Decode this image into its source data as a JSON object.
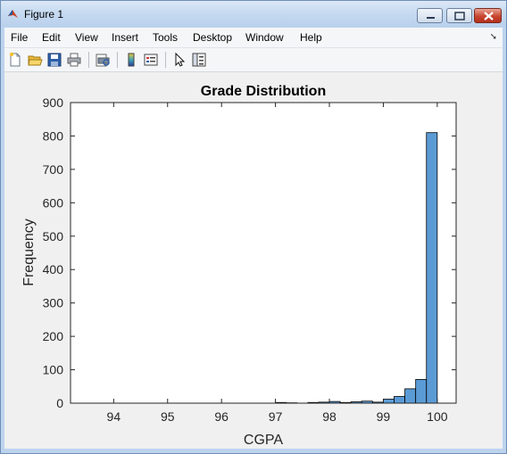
{
  "window": {
    "title": "Figure 1"
  },
  "menubar": {
    "items": [
      "File",
      "Edit",
      "View",
      "Insert",
      "Tools",
      "Desktop",
      "Window",
      "Help"
    ]
  },
  "toolbar": {
    "buttons": [
      "new-figure-icon",
      "open-file-icon",
      "save-icon",
      "print-icon",
      "print-preview-icon",
      "insert-colorbar-icon",
      "insert-legend-icon",
      "edit-plot-pointer-icon",
      "property-inspector-icon"
    ]
  },
  "colors": {
    "bar_fill": "#5b9bd5",
    "bar_edge": "#000000",
    "figure_bg": "#f0f0f0",
    "axes_bg": "#ffffff"
  },
  "chart_data": {
    "type": "bar",
    "title": "Grade Distribution",
    "xlabel": "CGPA",
    "ylabel": "Frequency",
    "xlim": [
      93.2,
      100.35
    ],
    "ylim": [
      0,
      900
    ],
    "xticks": [
      94,
      95,
      96,
      97,
      98,
      99,
      100
    ],
    "yticks": [
      0,
      100,
      200,
      300,
      400,
      500,
      600,
      700,
      800,
      900
    ],
    "grid": false,
    "bin_edges": [
      97.0,
      97.2,
      97.4,
      97.6,
      97.8,
      98.0,
      98.2,
      98.4,
      98.6,
      98.8,
      99.0,
      99.2,
      99.4,
      99.6,
      99.8,
      100.0
    ],
    "values": [
      2,
      1,
      0,
      2,
      3,
      5,
      2,
      4,
      6,
      3,
      12,
      20,
      43,
      71,
      810
    ]
  }
}
